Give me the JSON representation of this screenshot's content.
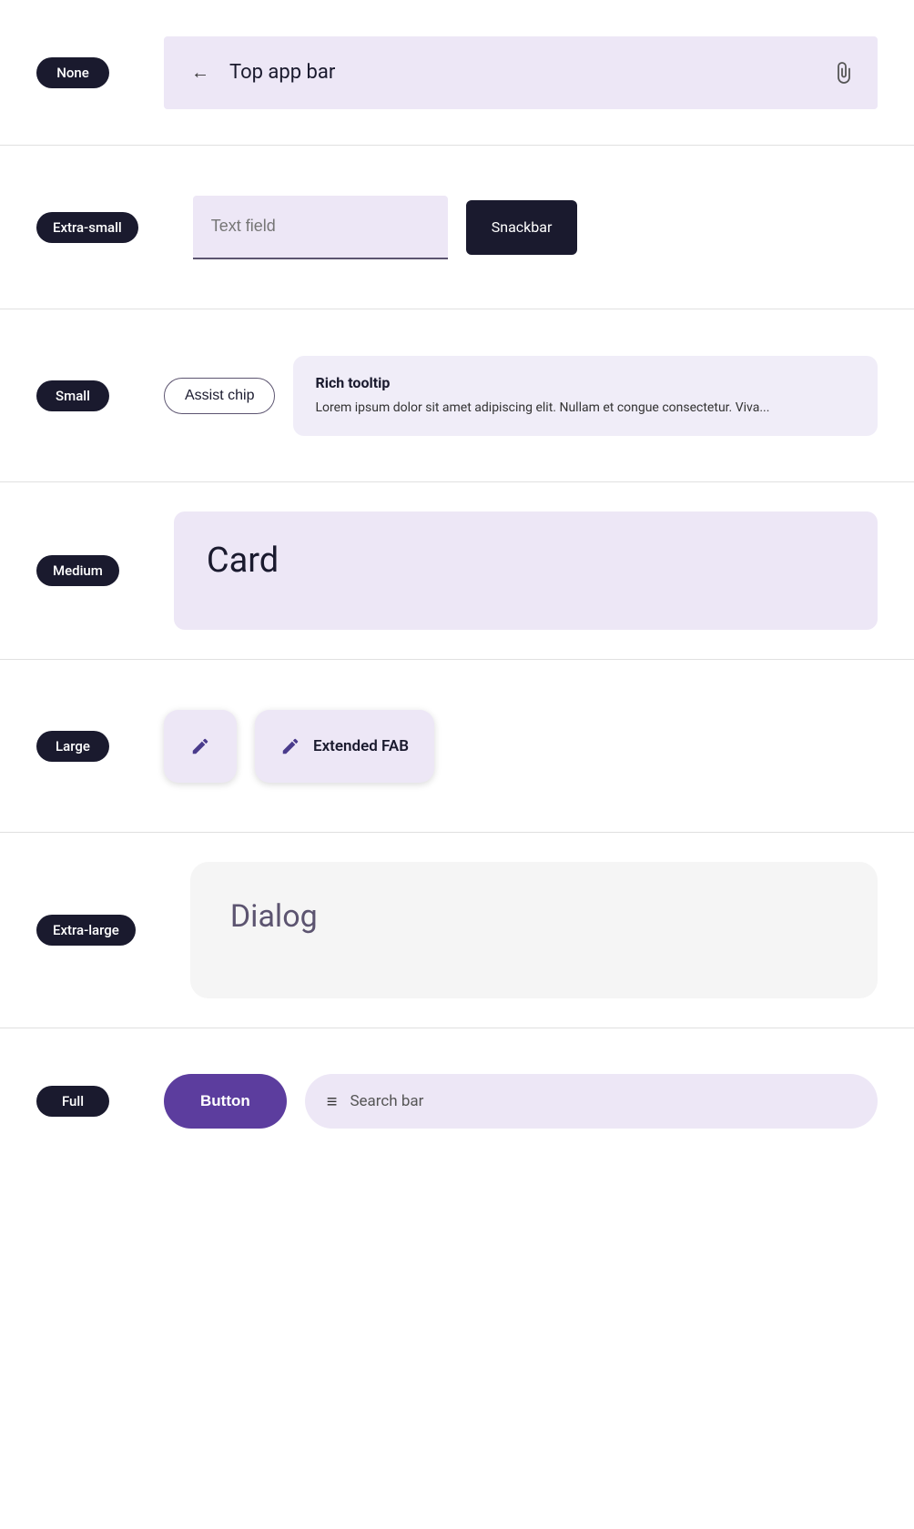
{
  "rows": {
    "none": {
      "badge": "None",
      "topAppBar": {
        "title": "Top app bar",
        "backIcon": "←",
        "attachIcon": "📎"
      }
    },
    "extraSmall": {
      "badge": "Extra-small",
      "textField": {
        "placeholder": "Text field"
      },
      "snackbar": {
        "label": "Snackbar"
      }
    },
    "small": {
      "badge": "Small",
      "assistChip": {
        "label": "Assist chip"
      },
      "richTooltip": {
        "title": "Rich tooltip",
        "body": "Lorem ipsum dolor sit amet adipiscing elit. Nullam et congue consectetur. Viva..."
      }
    },
    "medium": {
      "badge": "Medium",
      "card": {
        "title": "Card"
      }
    },
    "large": {
      "badge": "Large",
      "fab": {
        "icon": "pencil"
      },
      "extendedFab": {
        "icon": "pencil",
        "label": "Extended FAB"
      }
    },
    "extraLarge": {
      "badge": "Extra-large",
      "dialog": {
        "title": "Dialog"
      }
    },
    "full": {
      "badge": "Full",
      "button": {
        "label": "Button"
      },
      "searchBar": {
        "menuIcon": "≡",
        "label": "Search bar"
      }
    }
  }
}
